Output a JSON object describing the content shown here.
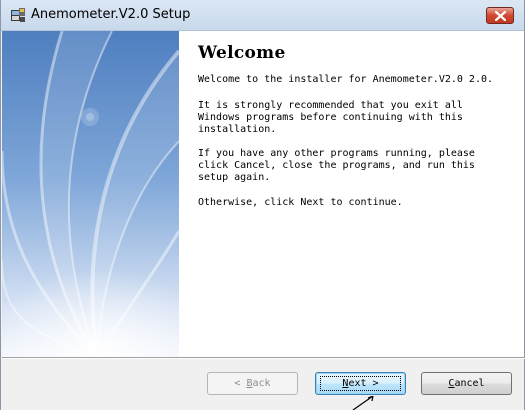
{
  "window": {
    "title": "Anemometer.V2.0 Setup"
  },
  "content": {
    "heading": "Welcome",
    "paragraphs": [
      "Welcome to the installer for Anemometer.V2.0 2.0.",
      "It is strongly recommended that you exit all\nWindows programs before continuing with this\ninstallation.",
      "If you have any other programs running, please\nclick Cancel, close the programs, and run this\nsetup again.",
      "Otherwise, click Next to continue."
    ]
  },
  "buttons": {
    "back": {
      "prefix": "< ",
      "mnemonic": "B",
      "rest": "ack",
      "enabled": false
    },
    "next": {
      "mnemonic": "N",
      "rest": "ext",
      "suffix": " >",
      "enabled": true,
      "focused": true
    },
    "cancel": {
      "mnemonic": "C",
      "rest": "ancel",
      "enabled": true
    }
  },
  "colors": {
    "banner_top": "#5a87c4",
    "banner_bottom": "#f2f4fb",
    "close_button": "#d2472f"
  },
  "icons": {
    "app": "installer-app-icon",
    "close": "close-icon",
    "cursor": "mouse-pointer-icon"
  }
}
